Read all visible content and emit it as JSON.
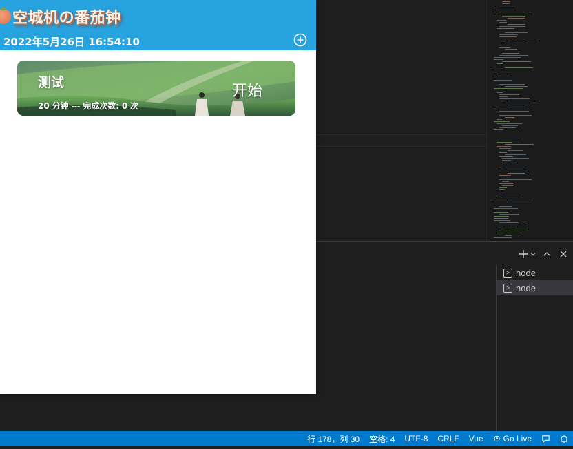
{
  "app": {
    "title": "空城机の番茄钟",
    "datetime": "2022年5月26日 16:54:10"
  },
  "tasks": [
    {
      "name": "测试",
      "duration": "20",
      "duration_unit": "分钟",
      "separator": "---",
      "completed_label": "完成次数:",
      "completed_count": "0",
      "completed_unit": "次",
      "start_label": "开始"
    }
  ],
  "terminal": {
    "instances": [
      {
        "label": "node",
        "active": false
      },
      {
        "label": "node",
        "active": true
      }
    ]
  },
  "statusbar": {
    "position": "行 178，列 30",
    "spaces": "空格: 4",
    "encoding": "UTF-8",
    "eol": "CRLF",
    "language": "Vue",
    "go_live": "Go Live"
  },
  "colors": {
    "header": "#27a3e0",
    "statusbar": "#007acc",
    "editor_bg": "#1e1e1e"
  }
}
